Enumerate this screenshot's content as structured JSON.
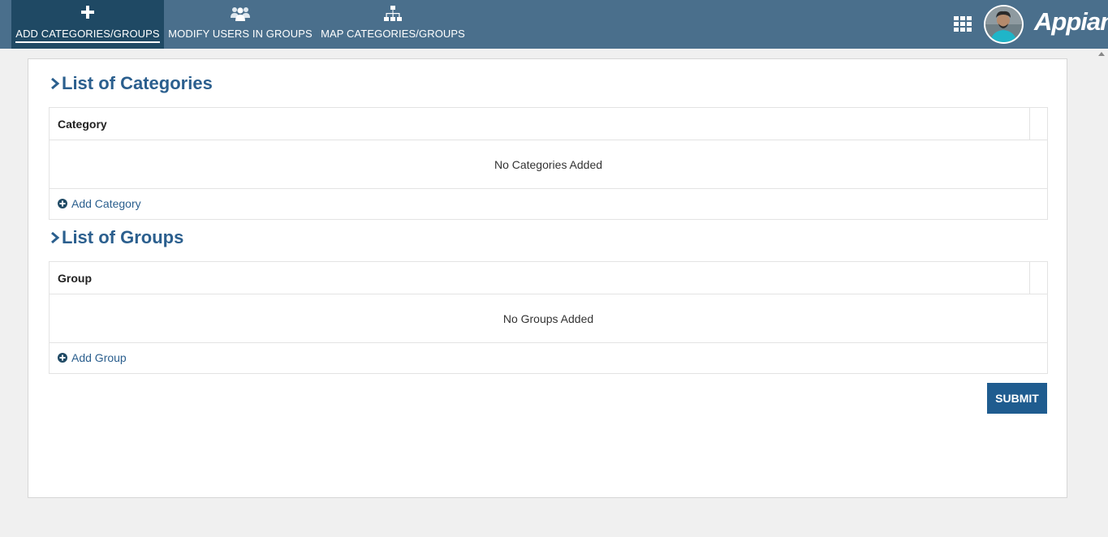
{
  "nav": {
    "tabs": [
      {
        "label": "ADD CATEGORIES/GROUPS",
        "icon": "plus-icon",
        "active": true
      },
      {
        "label": "MODIFY USERS IN GROUPS",
        "icon": "users-icon",
        "active": false
      },
      {
        "label": "MAP CATEGORIES/GROUPS",
        "icon": "sitemap-icon",
        "active": false
      }
    ],
    "apps_icon": "grid-apps-icon",
    "avatar": "user-avatar",
    "brand": "Appian"
  },
  "categories": {
    "title": "List of Categories",
    "column": "Category",
    "empty_text": "No Categories Added",
    "add_label": "Add Category"
  },
  "groups": {
    "title": "List of Groups",
    "column": "Group",
    "empty_text": "No Groups Added",
    "add_label": "Add Group"
  },
  "submit_label": "SUBMIT",
  "colors": {
    "topbar": "#4a6f8c",
    "active_tab": "#1f4964",
    "accent": "#2b5f8e",
    "button": "#1f5c8f"
  }
}
